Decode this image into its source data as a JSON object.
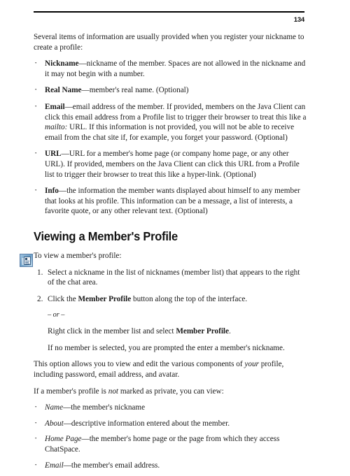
{
  "page": {
    "folio": "134"
  },
  "intro": {
    "text": "Several items of information are usually provided when you register your nickname to create a profile:"
  },
  "profile_fields": [
    {
      "term": "Nickname",
      "dash": "—",
      "description": "nickname of the member.  Spaces are not allowed in the nickname and it may not begin with a number."
    },
    {
      "term": "Real Name",
      "dash": "—",
      "description": "member's real name.  (Optional)"
    },
    {
      "term": "Email",
      "dash": "—",
      "description_part1": "email address of the member.  If provided, members on the Java Client can click this email address from a Profile list to trigger their browser to treat this like a ",
      "italic_token": "mailto:",
      "description_part2": " URL.  If this information is not provided, you will not be able to receive email from the chat site if, for example, you forget your password.  (Optional)"
    },
    {
      "term": "URL",
      "dash": "—",
      "description": "URL for a member's home page (or company home page, or any other URL).  If provided, members on the Java Client can click this URL from a Profile list to trigger their browser to treat this like a hyper-link.  (Optional)"
    },
    {
      "term": "Info",
      "dash": "—",
      "description": "the information the member wants displayed about himself to any member that looks at his profile.  This information can be a message, a list of interests, a favorite quote, or any other relevant text.  (Optional)"
    }
  ],
  "section": {
    "heading": "Viewing a Member's Profile",
    "lead_in": "To view a member's profile:"
  },
  "steps": [
    {
      "text": "Select a nickname in the list of nicknames (member list) that appears to the right of the chat area."
    },
    {
      "text_part1": "Click the ",
      "bold_token": "Member Profile",
      "text_part2": " button along the top of the interface."
    }
  ],
  "alternative": {
    "separator": "– or –",
    "text_part1": "Right click in the member list and select ",
    "bold_token": "Member Profile",
    "text_part2": ".",
    "note": "If no member is selected, you are prompted the enter a member's nickname."
  },
  "closing": {
    "paragraph_part1": "This option allows you to view and edit the various components of ",
    "paragraph_italic": "your",
    "paragraph_part2": " profile, including password, email address, and avatar.",
    "lead_in_part1": "If a member's profile is ",
    "lead_in_italic": "not",
    "lead_in_part2": " marked as private, you can view:"
  },
  "viewable_fields": [
    {
      "term": "Name",
      "dash": "—",
      "description": "the member's nickname"
    },
    {
      "term": "About",
      "dash": "—",
      "description": "descriptive information entered about the member."
    },
    {
      "term": "Home Page",
      "dash": "—",
      "description": "the member's home page or the page from which they access ChatSpace."
    },
    {
      "term": "Email",
      "dash": "—",
      "description": "the member's email address."
    }
  ],
  "icons": {
    "margin_button": "member-profile-toolbar-icon"
  }
}
